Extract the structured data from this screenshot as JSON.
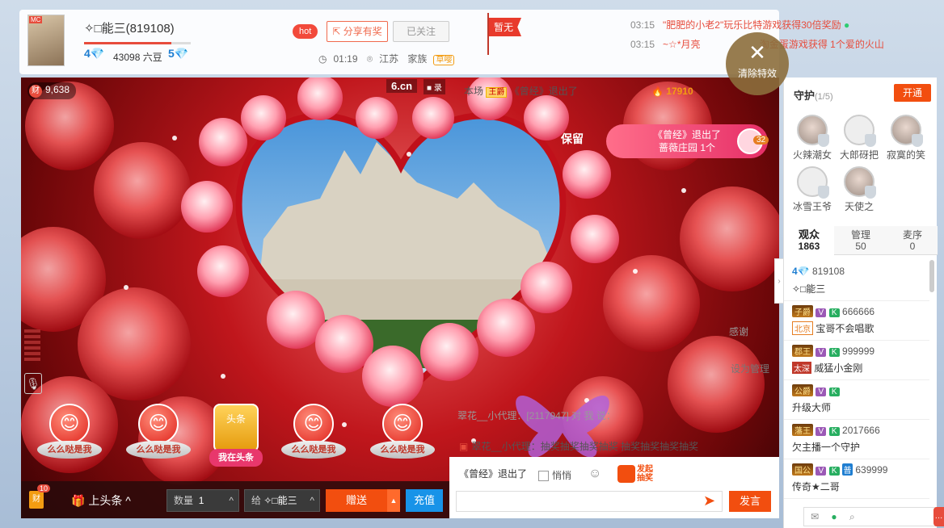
{
  "header": {
    "anchor_name": "✧□能三(819108)",
    "level_left": "4",
    "beans": "43098 六豆",
    "level_right": "5",
    "avatar_badge": "MC",
    "hot": "hot",
    "share": "分享有奖",
    "follow": "已关注",
    "time": "01:19",
    "location": "江苏",
    "family": "家族",
    "family_tag": "草嘤",
    "flag": "暂无",
    "news": [
      {
        "time": "03:15",
        "text": "\"肥肥的小老2\"玩乐比特游戏获得30倍奖励"
      },
      {
        "time": "03:15",
        "text": "~☆*月亮",
        "suffix": "淘金蛋游戏获得 1个爱的火山"
      }
    ],
    "clear_effects": "清除特效"
  },
  "video": {
    "wealth": "9,638",
    "wealth_icon": "财",
    "logo": "6.cn",
    "record": "■ 录"
  },
  "chat": {
    "line1_prefix": "本场",
    "line1_tag": "王爵",
    "line1_text": "《曾经》退出了",
    "coin": "17910",
    "popup_line1": "《曾经》退出了",
    "popup_line2": "蔷薇庄园 1个",
    "popup_count": "32",
    "baoliu": "保留",
    "ganxie": "感谢",
    "guanli": "设为管理",
    "line2": "翠花__小代理：[2117947] 对 我 说：",
    "lottery": "翠花__小代理：抽奖抽奖抽奖抽奖 抽奖抽奖抽奖抽奖"
  },
  "gifts": [
    {
      "label": "么么哒是我",
      "icon": "😊"
    },
    {
      "label": "么么哒是我",
      "icon": "😊"
    },
    {
      "label": "我在头条",
      "icon": "头条"
    },
    {
      "label": "么么哒是我",
      "icon": "😊"
    },
    {
      "label": "么么哒是我",
      "icon": "😊"
    }
  ],
  "bottombar": {
    "cai": "财",
    "cai_badge": "10",
    "toutiao": "上头条 ^",
    "qty_label": "数量",
    "qty_value": "1",
    "to_label": "给",
    "to_value": "✧□能三",
    "send": "赠送",
    "recharge": "充值"
  },
  "input": {
    "quoted": "《曾经》退出了",
    "secret": "悄悄",
    "lottery_btn": "发起抽奖",
    "placeholder": "",
    "speak": "发言"
  },
  "sidebar": {
    "guard_title": "守护",
    "guard_count": "(1/5)",
    "open_btn": "开通",
    "guards": [
      {
        "name": "火辣潮女"
      },
      {
        "name": "大郎砑把"
      },
      {
        "name": "寂寞的笑"
      },
      {
        "name": "冰雪王爷"
      },
      {
        "name": "天使之"
      }
    ],
    "tabs": [
      {
        "label": "观众",
        "count": "1863"
      },
      {
        "label": "管理",
        "count": "50"
      },
      {
        "label": "麦序",
        "count": "0"
      }
    ],
    "users": [
      {
        "level": "4",
        "id": "819108",
        "name": "✧□能三",
        "tag": "",
        "loc": ""
      },
      {
        "tag": "子爵",
        "id": "666666",
        "loc": "北京",
        "name": "宝哥不会唱歌"
      },
      {
        "tag": "郡王",
        "id": "999999",
        "loc": "太深",
        "name": "威猛小金刚"
      },
      {
        "tag": "公爵",
        "id": "",
        "loc": "",
        "name": "升级大师"
      },
      {
        "tag": "藩王",
        "id": "2017666",
        "loc": "",
        "name": "欠主播一个守护"
      },
      {
        "tag": "国公",
        "id": "639999",
        "loc": "",
        "name": "传奇★二哥"
      }
    ]
  },
  "status": {
    "icons": [
      "mail-icon",
      "check-icon",
      "zoom-icon"
    ]
  }
}
